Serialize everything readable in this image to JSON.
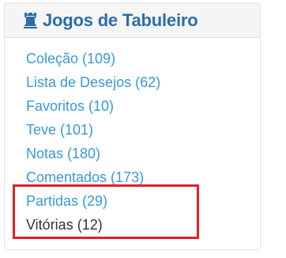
{
  "panel": {
    "title": "Jogos de Tabuleiro",
    "title_icon": "chess-rook-icon",
    "title_color": "#2c6ea8",
    "items": [
      {
        "label": "Coleção (109)",
        "link": true
      },
      {
        "label": "Lista de Desejos (62)",
        "link": true
      },
      {
        "label": "Favoritos (10)",
        "link": true
      },
      {
        "label": "Teve (101)",
        "link": true
      },
      {
        "label": "Notas (180)",
        "link": true
      },
      {
        "label": "Comentados (173)",
        "link": true
      },
      {
        "label": "Partidas (29)",
        "link": true
      },
      {
        "label": "Vitórias (12)",
        "link": false
      }
    ]
  },
  "colors": {
    "link": "#3a98d6",
    "plain_text": "#333333",
    "highlight": "#e3202a"
  }
}
